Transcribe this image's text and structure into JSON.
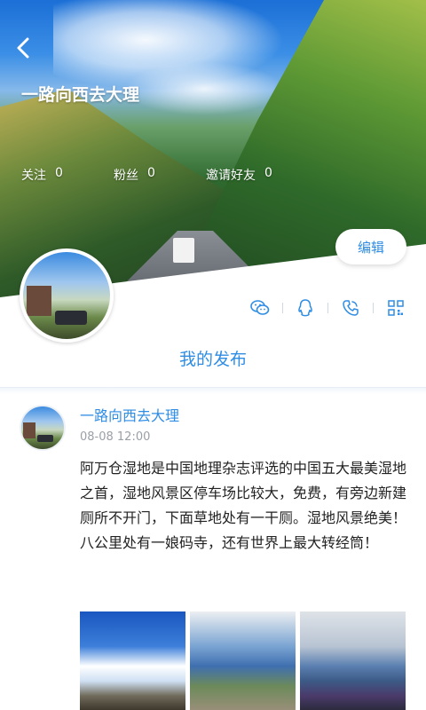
{
  "header": {
    "back_icon": "chevron-left-icon",
    "username": "一路向西去大理",
    "stats": [
      {
        "label": "关注",
        "value": "0"
      },
      {
        "label": "粉丝",
        "value": "0"
      },
      {
        "label": "邀请好友",
        "value": "0"
      }
    ],
    "edit_label": "编辑"
  },
  "share_icons": [
    "wechat-icon",
    "qq-icon",
    "phone-icon",
    "qrcode-icon"
  ],
  "section_title": "我的发布",
  "post": {
    "author": "一路向西去大理",
    "time": "08-08 12:00",
    "body": "阿万仓湿地是中国地理杂志评选的中国五大最美湿地之首，湿地风景区停车场比较大，免费，有旁边新建厕所不开门，下面草地处有一干厕。湿地风景绝美！\n八公里处有一娘码寺，还有世界上最大转经筒！",
    "photo_count": 3
  },
  "colors": {
    "accent": "#2f8de4",
    "text": "#222222",
    "muted": "#9aa0a6"
  }
}
